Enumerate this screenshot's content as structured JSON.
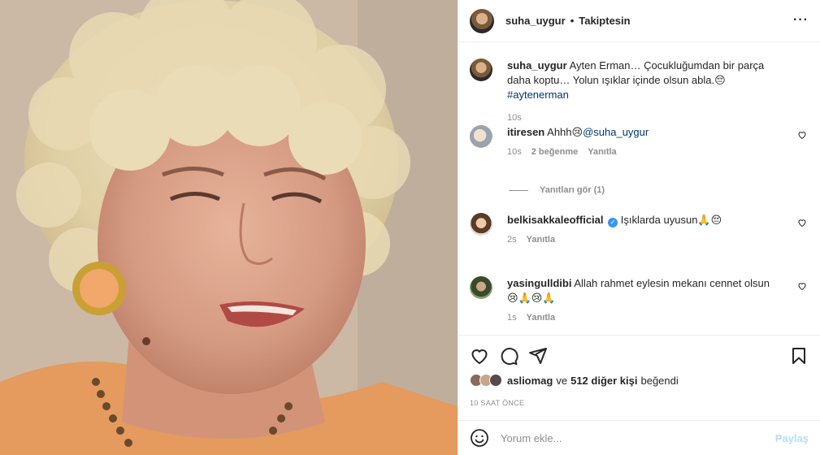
{
  "header": {
    "username": "suha_uygur",
    "separator": "•",
    "follow_status": "Takiptesin",
    "more_icon": "more-horizontal-icon"
  },
  "caption": {
    "username": "suha_uygur",
    "text": "Ayten Erman… Çocukluğumdan bir parça daha koptu… Yolun ışıklar içinde olsun abla.😔",
    "hashtag": "#aytenerman",
    "age": "10s"
  },
  "comments": [
    {
      "username": "itiresen",
      "text": "Ahhh😢",
      "mention": "@suha_uygur",
      "age": "10s",
      "likes": "2 beğenme",
      "reply": "Yanıtla"
    },
    {
      "username": "belkisakkaleofficial",
      "verified": true,
      "text": "Işıklarda uyusun🙏😔",
      "age": "2s",
      "reply": "Yanıtla"
    },
    {
      "username": "yasingulldibi",
      "text": "Allah rahmet eylesin mekanı cennet olsun 😢🙏😢🙏",
      "age": "1s",
      "reply": "Yanıtla"
    }
  ],
  "view_replies": "Yanıtları gör (1)",
  "likes": {
    "first_user": "asliomag",
    "connector": "ve",
    "others": "512 diğer kişi",
    "suffix": "beğendi"
  },
  "timestamp": "10 SAAT ÖNCE",
  "add_comment": {
    "placeholder": "Yorum ekle...",
    "share": "Paylaş"
  },
  "colors": {
    "link": "#00376b",
    "muted": "#8e8e8e",
    "verified": "#3897f0",
    "share_disabled": "#b2dffc"
  }
}
